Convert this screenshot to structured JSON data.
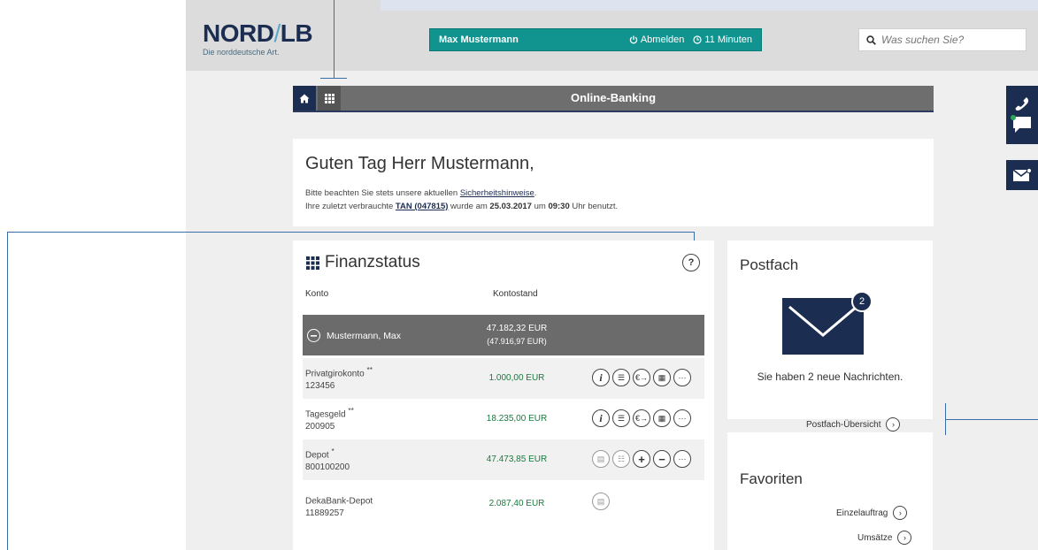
{
  "logo": {
    "main_a": "NORD",
    "slash": "/",
    "main_b": "LB",
    "tagline": "Die norddeutsche Art."
  },
  "userbar": {
    "name": "Max Mustermann",
    "logout_icon": "power-icon",
    "logout": "Abmelden",
    "timer_icon": "clock-icon",
    "timer": "11 Minuten"
  },
  "search": {
    "placeholder": "Was suchen Sie?",
    "icon": "search-icon"
  },
  "nav": {
    "title": "Online-Banking",
    "home_icon": "home-icon",
    "apps_icon": "grid-icon"
  },
  "greeting": {
    "title": "Guten Tag Herr Mustermann,",
    "line1_pre": "Bitte beachten Sie stets unsere aktuellen ",
    "line1_link": "Sicherheitshinweise",
    "line1_post": ".",
    "line2_pre": "Ihre zuletzt verbrauchte ",
    "line2_tan": "TAN (047815)",
    "line2_mid": " wurde am ",
    "line2_date": "25.03.2017",
    "line2_um": " um ",
    "line2_time": "09:30",
    "line2_post": " Uhr benutzt."
  },
  "finanzstatus": {
    "title": "Finanzstatus",
    "help": "?",
    "col_konto": "Konto",
    "col_kontostand": "Kontostand",
    "summary": {
      "name": "Mustermann, Max",
      "balance": "47.182,32 EUR",
      "balance_sub": "(47.916,97 EUR)"
    },
    "accounts": [
      {
        "name": "Privatgirokonto",
        "mark": "**",
        "number": "123456",
        "balance": "1.000,00 EUR"
      },
      {
        "name": "Tagesgeld",
        "mark": "**",
        "number": "200905",
        "balance": "18.235,00 EUR"
      },
      {
        "name": "Depot",
        "mark": "*",
        "number": "800100200",
        "balance": "47.473,85 EUR"
      },
      {
        "name": "DekaBank-Depot",
        "mark": "",
        "number": "11889257",
        "balance": "2.087,40 EUR"
      }
    ]
  },
  "postfach": {
    "title": "Postfach",
    "badge": "2",
    "message": "Sie haben 2 neue Nachrichten.",
    "overview_link": "Postfach-Übersicht"
  },
  "favoriten": {
    "title": "Favoriten",
    "links": [
      "Einzelauftrag",
      "Umsätze"
    ]
  },
  "colors": {
    "navy": "#1c2d52",
    "teal": "#11948f",
    "green": "#1a7a3e",
    "annotation": "#3a6ea8"
  }
}
